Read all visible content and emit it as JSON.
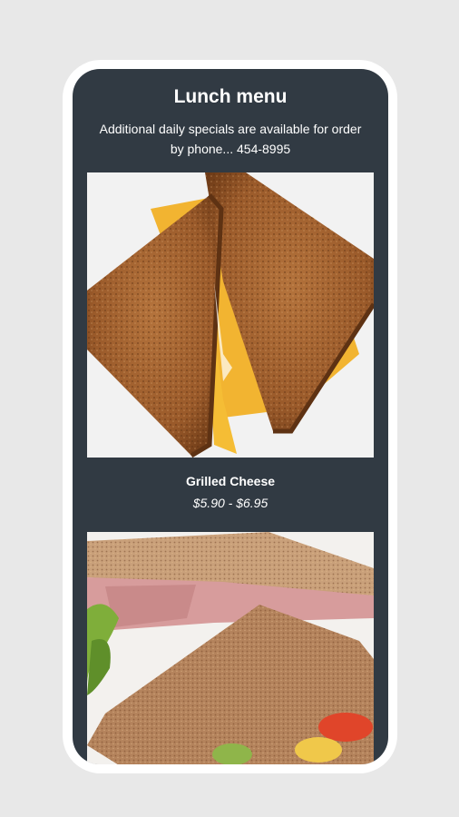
{
  "menu": {
    "title": "Lunch menu",
    "subtitle": "Additional daily specials are available for order by phone... 454-8995"
  },
  "items": [
    {
      "name": "Grilled Cheese",
      "price": "$5.90 - $6.95",
      "image": "grilled-cheese-photo"
    },
    {
      "image": "ham-sandwich-photo"
    }
  ]
}
